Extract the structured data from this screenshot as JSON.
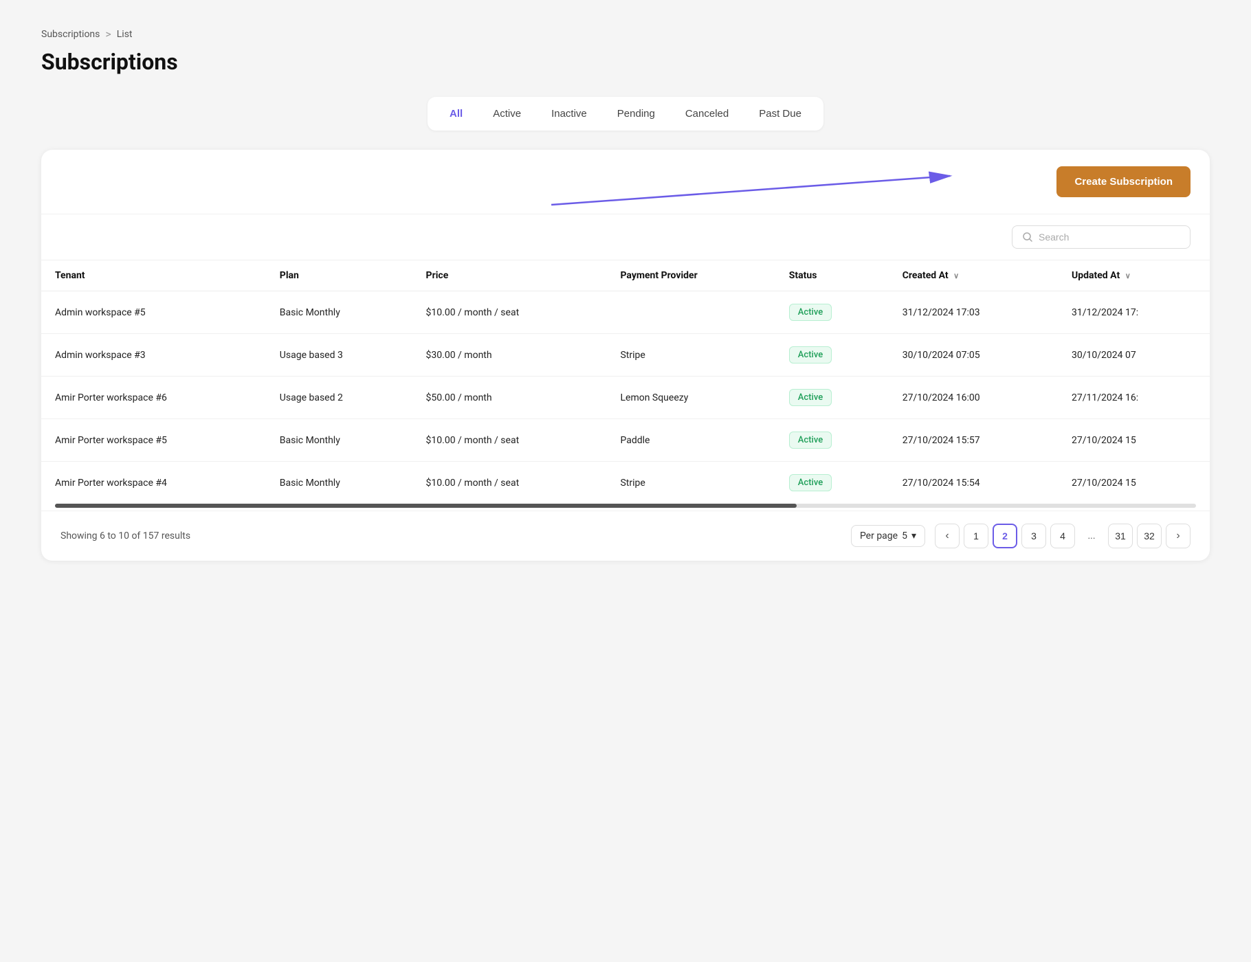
{
  "breadcrumb": {
    "parent": "Subscriptions",
    "separator": ">",
    "current": "List"
  },
  "page": {
    "title": "Subscriptions"
  },
  "filter_tabs": {
    "items": [
      {
        "label": "All",
        "active": true
      },
      {
        "label": "Active",
        "active": false
      },
      {
        "label": "Inactive",
        "active": false
      },
      {
        "label": "Pending",
        "active": false
      },
      {
        "label": "Canceled",
        "active": false
      },
      {
        "label": "Past Due",
        "active": false
      }
    ]
  },
  "toolbar": {
    "create_button_label": "Create Subscription"
  },
  "search": {
    "placeholder": "Search"
  },
  "table": {
    "columns": [
      {
        "key": "tenant",
        "label": "Tenant",
        "sortable": false
      },
      {
        "key": "plan",
        "label": "Plan",
        "sortable": false
      },
      {
        "key": "price",
        "label": "Price",
        "sortable": false
      },
      {
        "key": "payment_provider",
        "label": "Payment Provider",
        "sortable": false
      },
      {
        "key": "status",
        "label": "Status",
        "sortable": false
      },
      {
        "key": "created_at",
        "label": "Created At",
        "sortable": true
      },
      {
        "key": "updated_at",
        "label": "Updated At",
        "sortable": true
      }
    ],
    "rows": [
      {
        "tenant": "Admin workspace #5",
        "plan": "Basic Monthly",
        "price": "$10.00 / month / seat",
        "payment_provider": "",
        "status": "Active",
        "created_at": "31/12/2024 17:03",
        "updated_at": "31/12/2024 17:"
      },
      {
        "tenant": "Admin workspace #3",
        "plan": "Usage based 3",
        "price": "$30.00 / month",
        "payment_provider": "Stripe",
        "status": "Active",
        "created_at": "30/10/2024 07:05",
        "updated_at": "30/10/2024 07"
      },
      {
        "tenant": "Amir Porter workspace #6",
        "plan": "Usage based 2",
        "price": "$50.00 / month",
        "payment_provider": "Lemon Squeezy",
        "status": "Active",
        "created_at": "27/10/2024 16:00",
        "updated_at": "27/11/2024 16:"
      },
      {
        "tenant": "Amir Porter workspace #5",
        "plan": "Basic Monthly",
        "price": "$10.00 / month / seat",
        "payment_provider": "Paddle",
        "status": "Active",
        "created_at": "27/10/2024 15:57",
        "updated_at": "27/10/2024 15"
      },
      {
        "tenant": "Amir Porter workspace #4",
        "plan": "Basic Monthly",
        "price": "$10.00 / month / seat",
        "payment_provider": "Stripe",
        "status": "Active",
        "created_at": "27/10/2024 15:54",
        "updated_at": "27/10/2024 15"
      }
    ]
  },
  "pagination": {
    "results_text": "Showing 6 to 10 of 157 results",
    "per_page_label": "Per page",
    "per_page_value": "5",
    "current_page": 2,
    "pages": [
      1,
      2,
      3,
      4,
      "...",
      31,
      32
    ],
    "prev_icon": "‹",
    "next_icon": "›"
  }
}
